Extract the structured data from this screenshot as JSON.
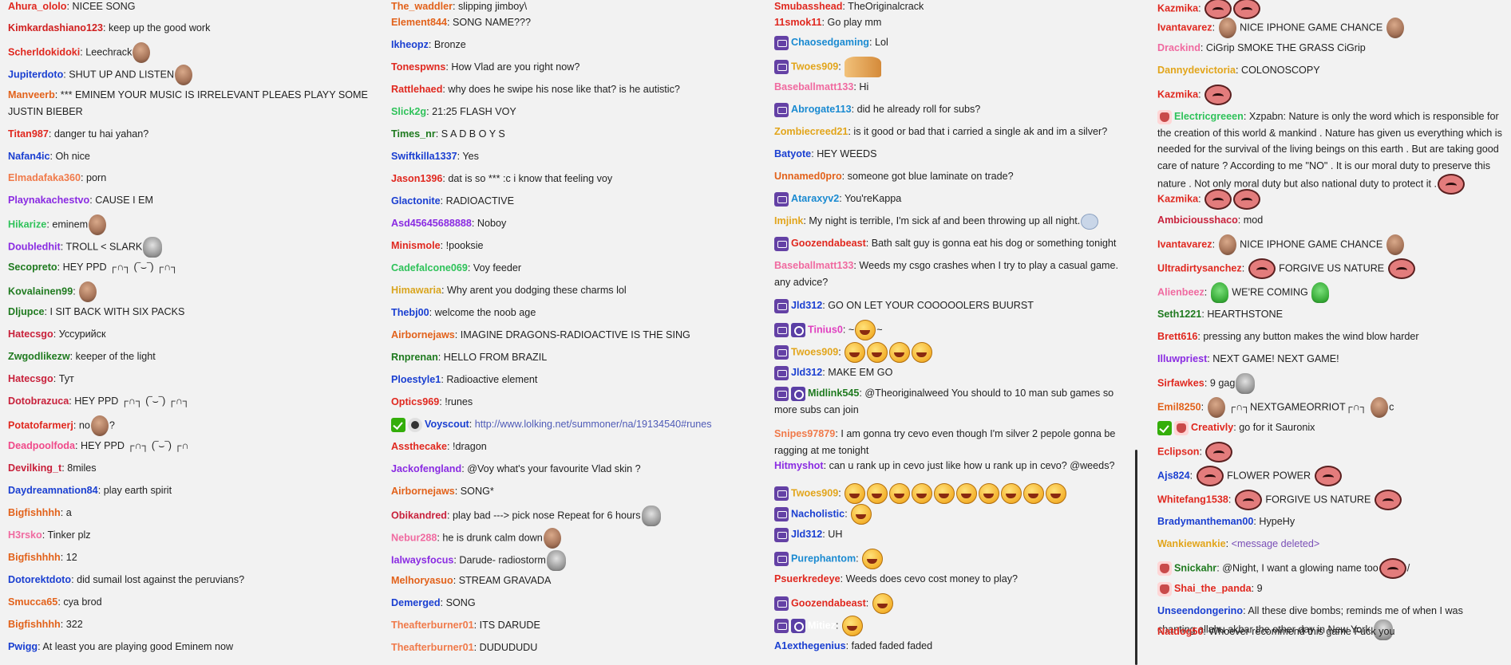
{
  "columns": [
    {
      "messages": [
        {
          "user": "Ahura_ololo",
          "color": "#e0281f",
          "text": "NICEE SONG"
        },
        {
          "user": "Kimkardashiano123",
          "color": "#d01f1f",
          "text": "keep up the good work"
        },
        {
          "user": "Scherldokidoki",
          "color": "#e0281f",
          "text": "Leechrack",
          "emotes": [
            "face"
          ]
        },
        {
          "user": "Jupiterdoto",
          "color": "#1a3fd1",
          "text": "SHUT UP AND LISTEN",
          "emotes": [
            "face"
          ]
        },
        {
          "user": "Manveerb",
          "color": "#e2621b",
          "text": "*** EMINEM YOUR MUSIC IS IRRELEVANT PLEAES PLAYY SOME JUSTIN BIEBER",
          "wrap": true
        },
        {
          "user": "Titan987",
          "color": "#e0281f",
          "text": "danger tu hai yahan?"
        },
        {
          "user": "Nafan4ic",
          "color": "#1a3fd1",
          "text": "Oh nice"
        },
        {
          "user": "Elmadafaka360",
          "color": "#f07a4a",
          "text": "porn"
        },
        {
          "user": "Playnakachestvo",
          "color": "#8a2be2",
          "text": "CAUSE I EM"
        },
        {
          "user": "Hikarize",
          "color": "#2fc25a",
          "text": "eminem",
          "emotes": [
            "face"
          ]
        },
        {
          "user": "Doubledhit",
          "color": "#8a2be2",
          "text": "TROLL < SLARK",
          "emotes": [
            "kappa"
          ]
        },
        {
          "user": "Secopreto",
          "color": "#1f7a1f",
          "text": "HEY PPD ┌∩┐ (‾⌣‾) ┌∩┐"
        },
        {
          "user": "Kovalainen99",
          "color": "#1f7a1f",
          "text": "",
          "emotes": [
            "face"
          ]
        },
        {
          "user": "Dljupce",
          "color": "#1f7a1f",
          "text": "I SIT BACK WITH SIX PACKS"
        },
        {
          "user": "Hatecsgo",
          "color": "#c8213b",
          "text": "Уссурийск"
        },
        {
          "user": "Zwgodlikezw",
          "color": "#1f7a1f",
          "text": "keeper of the light"
        },
        {
          "user": "Hatecsgo",
          "color": "#c8213b",
          "text": "Тут"
        },
        {
          "user": "Dotobrazuca",
          "color": "#c8213b",
          "text": "HEY PPD ┌∩┐ (‾⌣‾) ┌∩┐"
        },
        {
          "user": "Potatofarmerj",
          "color": "#e0281f",
          "text": "no",
          "emotes": [
            "face"
          ],
          "suffix": "?"
        },
        {
          "user": "Deadpoolfoda",
          "color": "#f04a8a",
          "text": "HEY PPD ┌∩┐ (‾⌣‾) ┌∩"
        },
        {
          "user": "Devilking_t",
          "color": "#c8213b",
          "text": "8miles"
        },
        {
          "user": "Daydreamnation84",
          "color": "#1a3fd1",
          "text": "play earth spirit"
        },
        {
          "user": "Bigfishhhh",
          "color": "#e2621b",
          "text": "a"
        },
        {
          "user": "H3rsko",
          "color": "#f06aa0",
          "text": "Tinker plz"
        },
        {
          "user": "Bigfishhhh",
          "color": "#e2621b",
          "text": "12"
        },
        {
          "user": "Dotorektdoto",
          "color": "#1a3fd1",
          "text": "did sumail lost against the peruvians?"
        },
        {
          "user": "Smucca65",
          "color": "#e2621b",
          "text": "cya brod"
        },
        {
          "user": "Bigfishhhh",
          "color": "#e2621b",
          "text": "322"
        },
        {
          "user": "Pwigg",
          "color": "#1a3fd1",
          "text": "At least you are playing good Eminem now"
        }
      ]
    },
    {
      "messages": [
        {
          "user": "The_waddler",
          "color": "#e2621b",
          "text": "slipping jimboy\\"
        },
        {
          "user": "Element844",
          "color": "#e2621b",
          "text": "SONG NAME???"
        },
        {
          "user": "Ikheopz",
          "color": "#1a3fd1",
          "text": "Bronze"
        },
        {
          "user": "Tonespwns",
          "color": "#e0281f",
          "text": "How Vlad are you right now?"
        },
        {
          "user": "Rattlehaed",
          "color": "#e0281f",
          "text": "why does he swipe his nose like that? is he autistic?"
        },
        {
          "user": "Slick2g",
          "color": "#2fc25a",
          "text": "21:25 FLASH VOY"
        },
        {
          "user": "Times_nr",
          "color": "#1f7a1f",
          "text": "S A D B O Y S"
        },
        {
          "user": "Swiftkilla1337",
          "color": "#1a3fd1",
          "text": "Yes"
        },
        {
          "user": "Jason1396",
          "color": "#e0281f",
          "text": "dat is so *** :c i know that feeling voy"
        },
        {
          "user": "Glactonite",
          "color": "#1a3fd1",
          "text": "RADIOACTIVE"
        },
        {
          "user": "Asd45645688888",
          "color": "#8a2be2",
          "text": "Noboy"
        },
        {
          "user": "Minismole",
          "color": "#e0281f",
          "text": "!pooksie"
        },
        {
          "user": "Cadefalcone069",
          "color": "#2fc25a",
          "text": "Voy feeder"
        },
        {
          "user": "Himawaria",
          "color": "#d9a51f",
          "text": "Why arent you dodging these charms lol"
        },
        {
          "user": "Thebj00",
          "color": "#1a3fd1",
          "text": "welcome the noob age"
        },
        {
          "user": "Airbornejaws",
          "color": "#e2621b",
          "text": "IMAGINE DRAGONS-RADIOACTIVE IS THE SING"
        },
        {
          "user": "Rnprenan",
          "color": "#1f7a1f",
          "text": "HELLO FROM BRAZIL"
        },
        {
          "user": "Ploestyle1",
          "color": "#1a3fd1",
          "text": "Radioactive element"
        },
        {
          "user": "Optics969",
          "color": "#e0281f",
          "text": "!runes"
        },
        {
          "user": "Voyscout",
          "color": "#1a3fd1",
          "text": "",
          "link": "http://www.lolking.net/summoner/na/19134540#runes",
          "badges": [
            "mod",
            "bits"
          ]
        },
        {
          "user": "Assthecake",
          "color": "#e0281f",
          "text": "!dragon"
        },
        {
          "user": "Jackofengland",
          "color": "#8a2be2",
          "text": "@Voy what's your favourite Vlad skin ?"
        },
        {
          "user": "Airbornejaws",
          "color": "#e2621b",
          "text": "SONG*"
        },
        {
          "user": "Obikandred",
          "color": "#c8213b",
          "text": "play bad ---> pick nose Repeat for 6 hours",
          "emotes": [
            "kappa"
          ]
        },
        {
          "user": "Nebur288",
          "color": "#f06aa0",
          "text": "he is drunk calm down",
          "emotes": [
            "face"
          ]
        },
        {
          "user": "Ialwaysfocus",
          "color": "#8a2be2",
          "text": "Darude- radiostorm",
          "emotes": [
            "kappa"
          ]
        },
        {
          "user": "Melhoryasuo",
          "color": "#e2621b",
          "text": "STREAM GRAVADA"
        },
        {
          "user": "Demerged",
          "color": "#1a3fd1",
          "text": "SONG"
        },
        {
          "user": "Theafterburner01",
          "color": "#f07a4a",
          "text": "ITS DARUDE"
        },
        {
          "user": "Theafterburner01",
          "color": "#f07a4a",
          "text": "DUDUDUDU"
        }
      ]
    },
    {
      "messages": [
        {
          "user": "Smubasshead",
          "color": "#e0281f",
          "text": "TheOriginalcrack"
        },
        {
          "user": "11smok11",
          "color": "#e0281f",
          "text": "Go play mm"
        },
        {
          "user": "Chaosedgaming",
          "color": "#1a8ad1",
          "text": "Lol",
          "badges": [
            "sub"
          ]
        },
        {
          "user": "Twoes909",
          "color": "#e2a51b",
          "text": "",
          "badges": [
            "sub"
          ],
          "emotes": [
            "hands"
          ]
        },
        {
          "user": "Baseballmatt133",
          "color": "#f06aa0",
          "text": "Hi"
        },
        {
          "user": "Abrogate113",
          "color": "#1a8ad1",
          "text": "did he already roll for subs?",
          "badges": [
            "sub"
          ]
        },
        {
          "user": "Zombiecreed21",
          "color": "#e2a51b",
          "text": "is it good or bad that i carried a single ak and im a silver?"
        },
        {
          "user": "Batyote",
          "color": "#1a3fd1",
          "text": "HEY WEEDS"
        },
        {
          "user": "Unnamed0pro",
          "color": "#e2621b",
          "text": "someone got blue laminate on trade?"
        },
        {
          "user": "Ataraxyv2",
          "color": "#1a8ad1",
          "text": "You'reKappa",
          "badges": [
            "sub"
          ]
        },
        {
          "user": "Imjink",
          "color": "#e2a51b",
          "text": "My night is terrible, I'm sick af and been throwing up all night.",
          "emotes": [
            "small"
          ]
        },
        {
          "user": "Goozendabeast",
          "color": "#e0281f",
          "text": "Bath salt guy is gonna eat his dog or something tonight",
          "badges": [
            "sub"
          ]
        },
        {
          "user": "Baseballmatt133",
          "color": "#f06aa0",
          "text": "Weeds my csgo crashes when I try to play a casual game. any advice?",
          "wrap": true
        },
        {
          "user": "Jld312",
          "color": "#1a3fd1",
          "text": "GO ON LET YOUR COOOOOLERS BUURST",
          "badges": [
            "sub"
          ]
        },
        {
          "user": "Tinius0",
          "color": "#e040c0",
          "text": "~",
          "badges": [
            "sub",
            "turbo"
          ],
          "emotes": [
            "smile"
          ],
          "suffix": "~"
        },
        {
          "user": "Twoes909",
          "color": "#e2a51b",
          "text": "",
          "badges": [
            "sub"
          ],
          "emotes": [
            "smile",
            "smile",
            "smile",
            "smile"
          ]
        },
        {
          "user": "Jld312",
          "color": "#1a3fd1",
          "text": "MAKE EM GO",
          "badges": [
            "sub"
          ]
        },
        {
          "user": "Midlink545",
          "color": "#1f7a1f",
          "text": "@Theoriginalweed You should to 10 man sub games so more subs can join",
          "wrap": true,
          "badges": [
            "sub",
            "turbo"
          ]
        },
        {
          "user": "Snipes97879",
          "color": "#f07a4a",
          "text": "I am gonna try cevo even though I'm silver 2 pepole gonna be ragging at me tonight",
          "wrap": true
        },
        {
          "user": "Hitmyshot",
          "color": "#8a2be2",
          "text": "can u rank up in cevo just like how u rank up in cevo? @weeds?"
        },
        {
          "user": "Twoes909",
          "color": "#e2a51b",
          "text": "",
          "badges": [
            "sub"
          ],
          "emotes": [
            "smile",
            "smile",
            "smile",
            "smile",
            "smile",
            "smile",
            "smile",
            "smile",
            "smile",
            "smile"
          ]
        },
        {
          "user": "Nacholistic",
          "color": "#1a3fd1",
          "text": "",
          "badges": [
            "sub"
          ],
          "emotes": [
            "smile"
          ]
        },
        {
          "user": "Jld312",
          "color": "#1a3fd1",
          "text": "UH",
          "badges": [
            "sub"
          ]
        },
        {
          "user": "Purephantom",
          "color": "#1a8ad1",
          "text": "",
          "badges": [
            "sub"
          ],
          "emotes": [
            "smile"
          ]
        },
        {
          "user": "Psuerkredeye",
          "color": "#e0281f",
          "text": "Weeds does cevo cost money to play?"
        },
        {
          "user": "Goozendabeast",
          "color": "#e0281f",
          "text": "",
          "badges": [
            "sub"
          ],
          "emotes": [
            "smile"
          ]
        },
        {
          "user": "Mitiez",
          "color": "#ffffff",
          "text": "",
          "badges": [
            "sub",
            "turbo"
          ],
          "emotes": [
            "smile"
          ]
        },
        {
          "user": "A1exthegenius",
          "color": "#1a3fd1",
          "text": "faded faded faded"
        }
      ]
    },
    {
      "messages": [
        {
          "user": "Kazmika",
          "color": "#e0281f",
          "text": "",
          "emotes": [
            "pink",
            "pink"
          ]
        },
        {
          "user": "Ivantavarez",
          "color": "#e0281f",
          "text": "",
          "emotes": [
            "face"
          ],
          "text2": "NICE IPHONE GAME CHANCE",
          "emotes2": [
            "face"
          ]
        },
        {
          "user": "Drackind",
          "color": "#f06aa0",
          "text": "CiGrip SMOKE THE GRASS CiGrip"
        },
        {
          "user": "Dannydevictoria",
          "color": "#e2a51b",
          "text": "COLONOSCOPY"
        },
        {
          "user": "Kazmika",
          "color": "#e0281f",
          "text": "",
          "emotes": [
            "pink"
          ]
        },
        {
          "user": "Electricgreeen",
          "color": "#2fc25a",
          "text": "Xzpabn: Nature is only the word which is responsible for the creation of this world & mankind . Nature has given us everything which is needed for the survival of the living beings on this earth . But are taking good care of nature ? According to me \"NO\" . It is our moral duty to preserve this nature . Not only moral duty but also national duty to protect it .",
          "wrap": true,
          "badges": [
            "red"
          ],
          "emotes": [
            "pink"
          ]
        },
        {
          "user": "Kazmika",
          "color": "#e0281f",
          "text": "",
          "emotes": [
            "pink",
            "pink"
          ]
        },
        {
          "user": "Ambiciousshaco",
          "color": "#c8213b",
          "text": "mod"
        },
        {
          "user": "Ivantavarez",
          "color": "#e0281f",
          "text": "",
          "emotes": [
            "face"
          ],
          "text2": "NICE IPHONE GAME CHANCE",
          "emotes2": [
            "face"
          ]
        },
        {
          "user": "Ultradirtysanchez",
          "color": "#e0281f",
          "text": "",
          "emotes": [
            "pink"
          ],
          "text2": "FORGIVE US NATURE",
          "emotes2": [
            "pink"
          ]
        },
        {
          "user": "Alienbeez",
          "color": "#f06aa0",
          "text": "",
          "emotes": [
            "frog"
          ],
          "text2": "WE'RE COMING",
          "emotes2": [
            "frog"
          ]
        },
        {
          "user": "Seth1221",
          "color": "#1f7a1f",
          "text": "HEARTHSTONE"
        },
        {
          "user": "Brett616",
          "color": "#e0281f",
          "text": "pressing any button makes the wind blow harder"
        },
        {
          "user": "Illuwpriest",
          "color": "#8a2be2",
          "text": "NEXT GAME! NEXT GAME!"
        },
        {
          "user": "Sirfawkes",
          "color": "#e0281f",
          "text": "9 gag",
          "emotes": [
            "kappa"
          ]
        },
        {
          "user": "Emil8250",
          "color": "#e2621b",
          "text": "",
          "emotes": [
            "face"
          ],
          "text2": "┌∩┐NEXTGAMEORRIOT┌∩┐",
          "emotes2": [
            "face"
          ],
          "suffix": "c"
        },
        {
          "user": "Creativly",
          "color": "#e0281f",
          "text": "go for it Sauronix",
          "badges": [
            "mod",
            "red"
          ]
        },
        {
          "user": "Eclipson",
          "color": "#e0281f",
          "text": "",
          "emotes": [
            "pink"
          ]
        },
        {
          "user": "Ajs824",
          "color": "#1a3fd1",
          "text": "",
          "emotes": [
            "pink"
          ],
          "text2": "FLOWER POWER",
          "emotes2": [
            "pink"
          ]
        },
        {
          "user": "Whitefang1538",
          "color": "#e0281f",
          "text": "",
          "emotes": [
            "pink"
          ],
          "text2": "FORGIVE US NATURE",
          "emotes2": [
            "pink"
          ]
        },
        {
          "user": "Bradymantheman00",
          "color": "#1a3fd1",
          "text": "HypeHy"
        },
        {
          "user": "Wankiewankie",
          "color": "#e2a51b",
          "text": "",
          "deleted": "<message deleted>"
        },
        {
          "user": "Snickahr",
          "color": "#1f7a1f",
          "text": "@Night, I want a glowing name too",
          "badges": [
            "red"
          ],
          "emotes": [
            "pink"
          ],
          "suffix": "/"
        },
        {
          "user": "Shai_the_panda",
          "color": "#e0281f",
          "text": "9",
          "badges": [
            "red"
          ]
        },
        {
          "user": "Unseendongerino",
          "color": "#1a3fd1",
          "text": "All these dive bombs; reminds me of when I was chanting allahu akbar the other day in New York.",
          "wrap": true,
          "emotes": [
            "kappa"
          ]
        },
        {
          "user": "Natdog50",
          "color": "#e0281f",
          "text": "Whoever recommend this game Fuck you"
        }
      ]
    }
  ]
}
